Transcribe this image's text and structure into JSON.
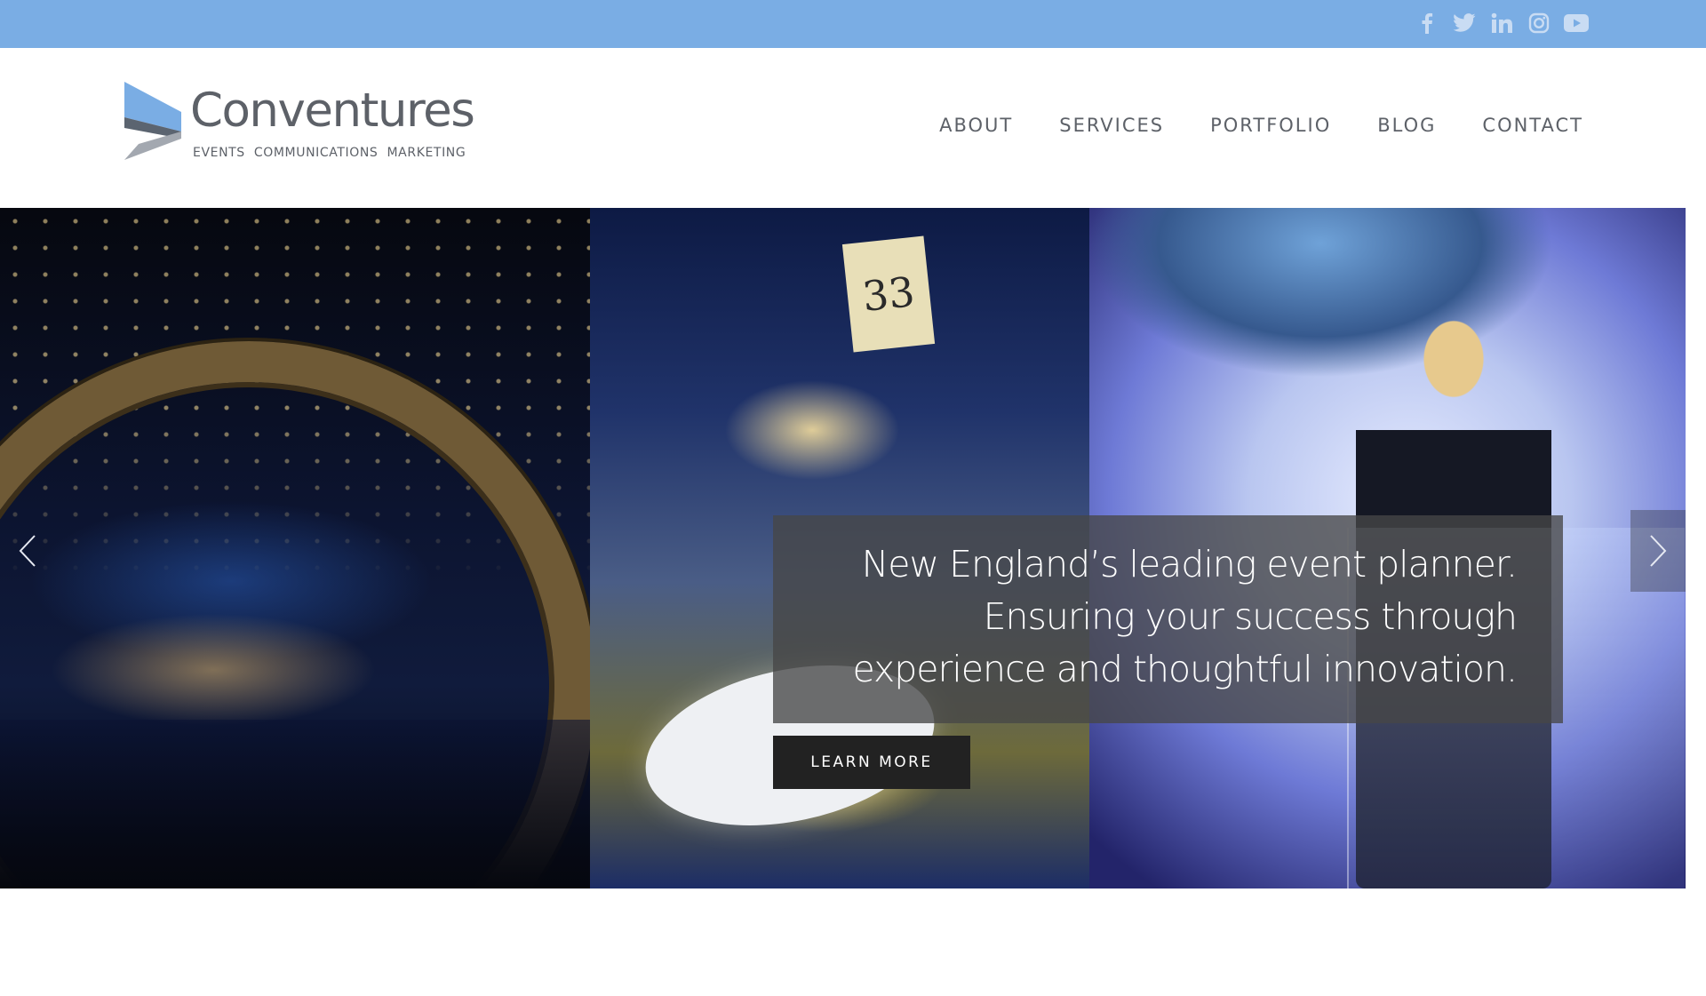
{
  "social": {
    "color": "#c9dcf3",
    "icons": [
      "facebook-icon",
      "twitter-icon",
      "linkedin-icon",
      "instagram-icon",
      "youtube-icon"
    ]
  },
  "brand": {
    "name": "Conventures",
    "tagline": "EVENTS  COMMUNICATIONS  MARKETING",
    "accent": "#7aade4"
  },
  "nav": {
    "items": [
      {
        "label": "ABOUT"
      },
      {
        "label": "SERVICES"
      },
      {
        "label": "PORTFOLIO"
      },
      {
        "label": "BLOG"
      },
      {
        "label": "CONTACT"
      }
    ]
  },
  "hero": {
    "table_card": "33",
    "caption_lines": [
      "New England’s leading event planner.",
      "Ensuring your success through",
      "experience and thoughtful innovation."
    ],
    "cta_label": "LEARN MORE",
    "prev_icon": "chevron-left-icon",
    "next_icon": "chevron-right-icon"
  }
}
